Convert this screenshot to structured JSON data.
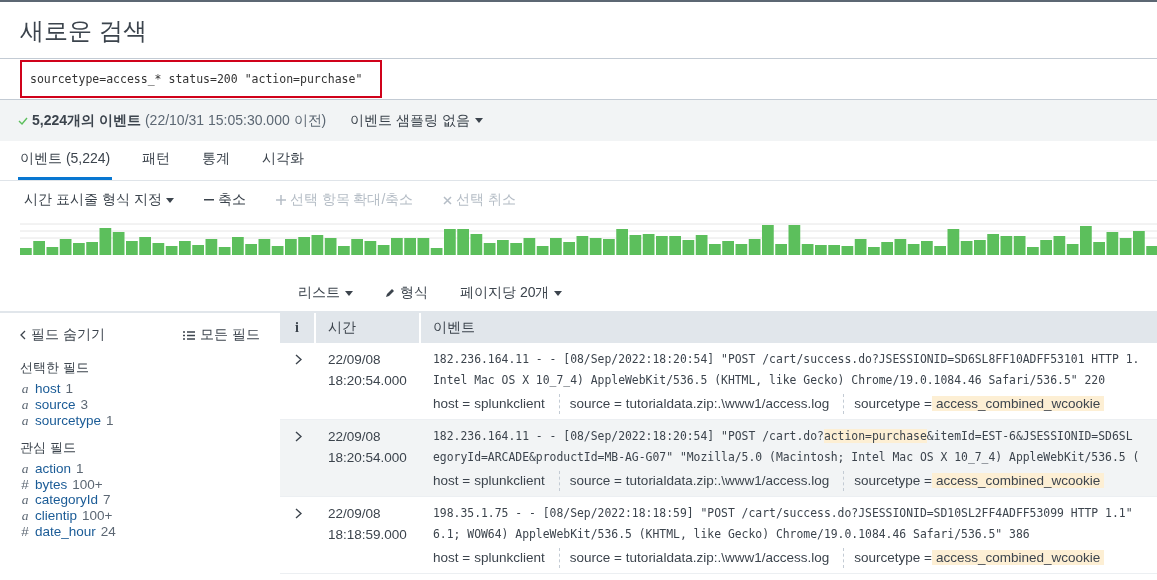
{
  "title": "새로운 검색",
  "search": {
    "value": "sourcetype=access_* status=200 \"action=purchase\""
  },
  "status": {
    "count": "5,224개의 이벤트",
    "time": "(22/10/31 15:05:30.000 이전)",
    "sampling": "이벤트 샘플링 없음"
  },
  "tabs": [
    {
      "label": "이벤트 (5,224)",
      "selected": true
    },
    {
      "label": "패턴",
      "selected": false
    },
    {
      "label": "통계",
      "selected": false
    },
    {
      "label": "시각화",
      "selected": false
    }
  ],
  "timeline_toolbar": [
    {
      "label": "시간 표시줄 형식 지정",
      "kind": "dropdown",
      "disabled": false
    },
    {
      "label": "축소",
      "kind": "minus",
      "disabled": false
    },
    {
      "label": "선택 항목 확대/축소",
      "kind": "plus",
      "disabled": true
    },
    {
      "label": "선택 취소",
      "kind": "clear",
      "disabled": true
    }
  ],
  "results_toolbar": [
    {
      "label": "리스트",
      "kind": "dropdown"
    },
    {
      "label": "형식",
      "kind": "edit"
    },
    {
      "label": "페이지당 20개",
      "kind": "dropdown"
    }
  ],
  "sidebar": {
    "hide_fields": "필드 숨기기",
    "all_fields": "모든 필드",
    "groups": [
      {
        "title": "선택한 필드",
        "fields": [
          {
            "type": "a",
            "name": "host",
            "count": "1"
          },
          {
            "type": "a",
            "name": "source",
            "count": "3"
          },
          {
            "type": "a",
            "name": "sourcetype",
            "count": "1"
          }
        ]
      },
      {
        "title": "관심 필드",
        "fields": [
          {
            "type": "a",
            "name": "action",
            "count": "1"
          },
          {
            "type": "#",
            "name": "bytes",
            "count": "100+"
          },
          {
            "type": "a",
            "name": "categoryId",
            "count": "7"
          },
          {
            "type": "a",
            "name": "clientip",
            "count": "100+"
          },
          {
            "type": "#",
            "name": "date_hour",
            "count": "24"
          }
        ]
      }
    ]
  },
  "table": {
    "columns": [
      "i",
      "시간",
      "이벤트"
    ],
    "rows": [
      {
        "highlighted": false,
        "time": [
          "22/09/08",
          "18:20:54.000"
        ],
        "lines": [
          [
            {
              "text": "182.236.164.11 - - [08/Sep/2022:18:20:54] \"POST /cart/success.do?JSESSIONID=SD6SL8FF10ADFF53101 HTTP 1.",
              "highlighted": false
            }
          ],
          [
            {
              "text": "Intel Mac OS X 10_7_4) AppleWebKit/536.5 (KHTML, like Gecko) Chrome/19.0.1084.46 Safari/536.5\" 220",
              "highlighted": false
            }
          ]
        ],
        "fields": [
          {
            "key": "host =",
            "value": "splunkclient",
            "highlighted": false
          },
          {
            "key": "source =",
            "value": "tutorialdata.zip:.\\www1/access.log",
            "highlighted": false
          },
          {
            "key": "sourcetype =",
            "value": "access_combined_wcookie",
            "highlighted": true
          }
        ]
      },
      {
        "highlighted": true,
        "time": [
          "22/09/08",
          "18:20:54.000"
        ],
        "lines": [
          [
            {
              "text": "182.236.164.11 - - [08/Sep/2022:18:20:54] \"POST /cart.do?",
              "highlighted": false
            },
            {
              "text": "action=purchase",
              "highlighted": true
            },
            {
              "text": "&itemId=EST-6&JSESSIONID=SD6SL",
              "highlighted": false
            }
          ],
          [
            {
              "text": "egoryId=ARCADE&productId=MB-AG-G07\" \"Mozilla/5.0 (Macintosh; Intel Mac OS X 10_7_4) AppleWebKit/536.5 (",
              "highlighted": false
            }
          ]
        ],
        "fields": [
          {
            "key": "host =",
            "value": "splunkclient",
            "highlighted": false
          },
          {
            "key": "source =",
            "value": "tutorialdata.zip:.\\www1/access.log",
            "highlighted": false
          },
          {
            "key": "sourcetype =",
            "value": "access_combined_wcookie",
            "highlighted": true
          }
        ]
      },
      {
        "highlighted": false,
        "time": [
          "22/09/08",
          "18:18:59.000"
        ],
        "lines": [
          [
            {
              "text": "198.35.1.75 - - [08/Sep/2022:18:18:59] \"POST /cart/success.do?JSESSIONID=SD10SL2FF4ADFF53099 HTTP 1.1\"",
              "highlighted": false
            }
          ],
          [
            {
              "text": "6.1; WOW64) AppleWebKit/536.5 (KHTML, like Gecko) Chrome/19.0.1084.46 Safari/536.5\" 386",
              "highlighted": false
            }
          ]
        ],
        "fields": [
          {
            "key": "host =",
            "value": "splunkclient",
            "highlighted": false
          },
          {
            "key": "source =",
            "value": "tutorialdata.zip:.\\www1/access.log",
            "highlighted": false
          },
          {
            "key": "sourcetype =",
            "value": "access_combined_wcookie",
            "highlighted": true
          }
        ]
      }
    ]
  }
}
